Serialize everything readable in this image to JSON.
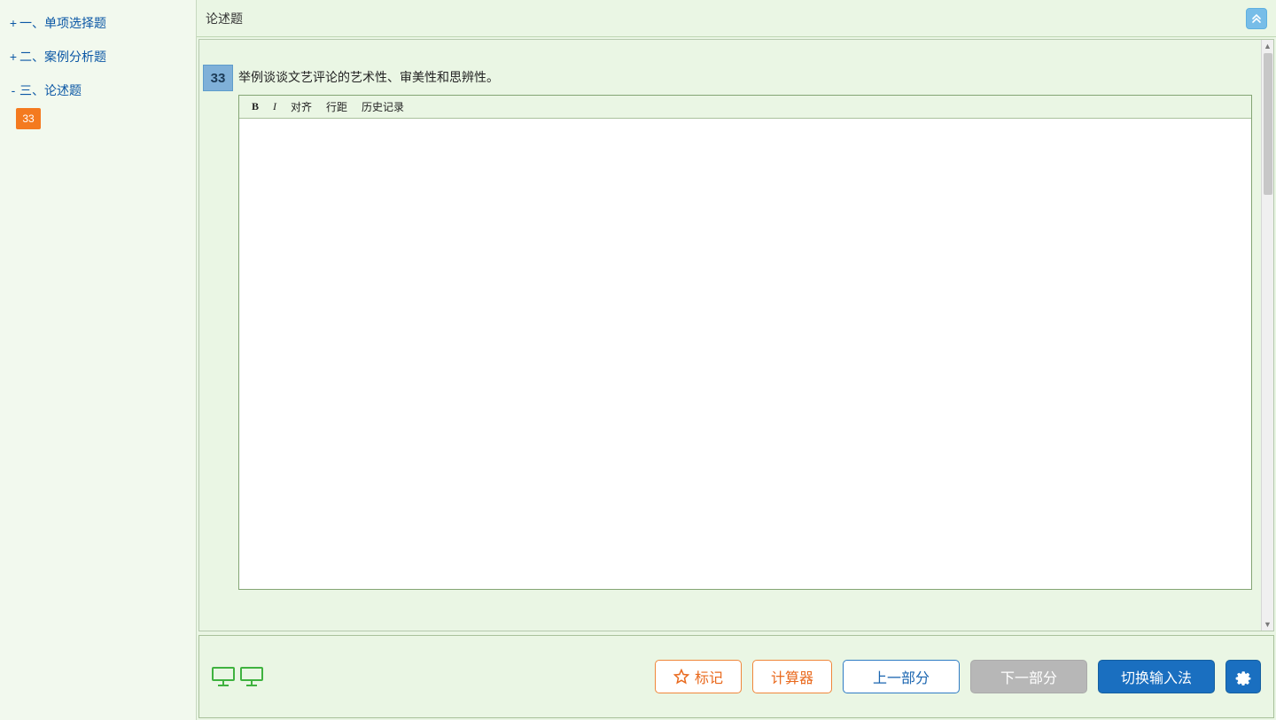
{
  "sidebar": {
    "items": [
      {
        "sign": "+",
        "label": "一、单项选择题",
        "expanded": false
      },
      {
        "sign": "+",
        "label": "二、案例分析题",
        "expanded": false
      },
      {
        "sign": "-",
        "label": "三、论述题",
        "expanded": true
      }
    ],
    "active_question_number": "33"
  },
  "header": {
    "section_title": "论述题"
  },
  "question": {
    "number": "33",
    "text": "举例谈谈文艺评论的艺术性、审美性和思辨性。"
  },
  "editor": {
    "toolbar": {
      "bold": "B",
      "italic": "I",
      "align": "对齐",
      "line_spacing": "行距",
      "history": "历史记录"
    },
    "content": "",
    "placeholder": ""
  },
  "footer": {
    "mark": "标记",
    "calculator": "计算器",
    "prev_section": "上一部分",
    "next_section": "下一部分",
    "switch_ime": "切换输入法"
  },
  "colors": {
    "bg": "#eaf6e4",
    "accent_orange": "#f47a1f",
    "accent_blue": "#1a6fc0",
    "link_blue": "#0b57a5",
    "disabled": "#b7b7b7"
  }
}
